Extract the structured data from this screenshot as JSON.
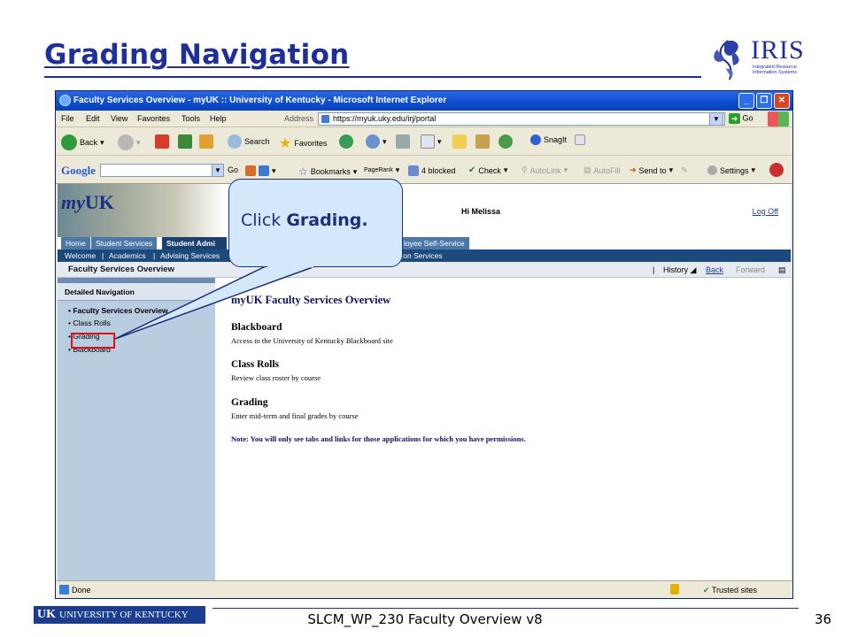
{
  "slide": {
    "title": "Grading Navigation",
    "logo_text": "IRIS",
    "logo_subtext": "Integrated Resource Information Systems",
    "footer_logo_text": "UNIVERSITY OF KENTUCKY",
    "footer_logo_mark": "UK",
    "footer_text": "SLCM_WP_230 Faculty Overview v8",
    "page_number": "36"
  },
  "callout": {
    "text_plain": "Click",
    "text_bold": "Grading."
  },
  "browser": {
    "title": "Faculty Services Overview - myUK :: University of Kentucky - Microsoft Internet Explorer",
    "menu": [
      "File",
      "Edit",
      "View",
      "Favorites",
      "Tools",
      "Help"
    ],
    "address_label": "Address",
    "address_value": "https://myuk.uky.edu/irj/portal",
    "go_label": "Go",
    "toolbar": {
      "back": "Back",
      "search": "Search",
      "favorites": "Favorites",
      "snagit": "SnagIt"
    },
    "googlebar": {
      "logo": "Google",
      "go": "Go",
      "bookmarks": "Bookmarks",
      "pagerank": "PageRank",
      "blocked": "4 blocked",
      "check": "Check",
      "autolink": "AutoLink",
      "autofill": "AutoFill",
      "sendto": "Send to",
      "settings": "Settings"
    },
    "status_text": "Done",
    "status_zone": "Trusted sites"
  },
  "portal": {
    "logo_pre": "my",
    "logo_bold": "UK",
    "greeting": "Hi Melissa",
    "logoff": "Log Off",
    "tabs": [
      "Home",
      "Student Services",
      "Student Admi",
      "loyee Self-Service"
    ],
    "subnav": [
      "Welcome",
      "Academics",
      "Advising Services",
      "tion Services"
    ],
    "page_title": "Faculty Services Overview",
    "history": "History",
    "back": "Back",
    "forward": "Forward",
    "detailed_nav_title": "Detailed Navigation",
    "nav_items": [
      "Faculty Services Overview",
      "Class Rolls",
      "Grading",
      "Blackboard"
    ],
    "content_title": "myUK Faculty Services Overview",
    "sections": [
      {
        "heading": "Blackboard",
        "desc": "Access to the University of Kentucky Blackboard site"
      },
      {
        "heading": "Class Rolls",
        "desc": "Review class roster by course"
      },
      {
        "heading": "Grading",
        "desc": "Enter mid-term and final grades by course"
      }
    ],
    "note": "Note:  You will only see tabs and links for those applications for which you have permissions."
  }
}
